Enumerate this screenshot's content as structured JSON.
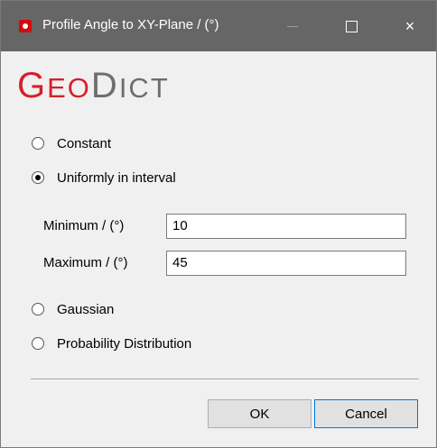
{
  "window": {
    "title": "Profile Angle to XY-Plane / (°)",
    "icon": "geodict-app-icon",
    "controls": {
      "minimize": "minimize-icon",
      "maximize": "maximize-icon",
      "close": "×"
    }
  },
  "logo": {
    "text_red_cap": "G",
    "text_red_rest": "EO",
    "text_gray_cap": "D",
    "text_gray_rest": "ICT",
    "colors": {
      "red": "#d81e2b",
      "gray": "#6e6e6e"
    }
  },
  "options": [
    {
      "label": "Constant",
      "checked": false
    },
    {
      "label": "Uniformly in interval",
      "checked": true
    },
    {
      "label": "Gaussian",
      "checked": false
    },
    {
      "label": "Probability Distribution",
      "checked": false
    }
  ],
  "interval": {
    "minimum_label": "Minimum / (°)",
    "minimum_value": "10",
    "maximum_label": "Maximum / (°)",
    "maximum_value": "45"
  },
  "buttons": {
    "ok": "OK",
    "cancel": "Cancel"
  },
  "colors": {
    "titlebar": "#666666",
    "accent": "#0078d7"
  }
}
